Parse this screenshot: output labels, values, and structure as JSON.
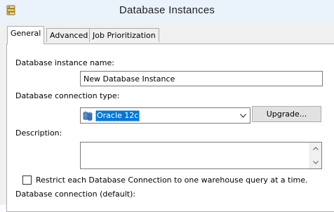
{
  "window": {
    "title": "Database Instances",
    "icon": "database-stack-icon"
  },
  "tabs": [
    {
      "label": "General",
      "active": true
    },
    {
      "label": "Advanced",
      "active": false
    },
    {
      "label": "Job Prioritization",
      "active": false
    }
  ],
  "form": {
    "instance_name_label": "Database instance name:",
    "instance_name_value": "New Database Instance",
    "connection_type_label": "Database connection type:",
    "connection_type_value": "Oracle 12c",
    "connection_type_icon": "database-cylinders-icon",
    "upgrade_label": "Upgrade...",
    "description_label": "Description:",
    "description_value": "",
    "restrict_label": "Restrict each Database Connection to one warehouse query at a time.",
    "restrict_checked": false,
    "connection_default_label": "Database connection (default):"
  },
  "colors": {
    "selection": "#0078d7",
    "titlebar": "#eaf3fc",
    "dialog": "#f0f0f0"
  }
}
